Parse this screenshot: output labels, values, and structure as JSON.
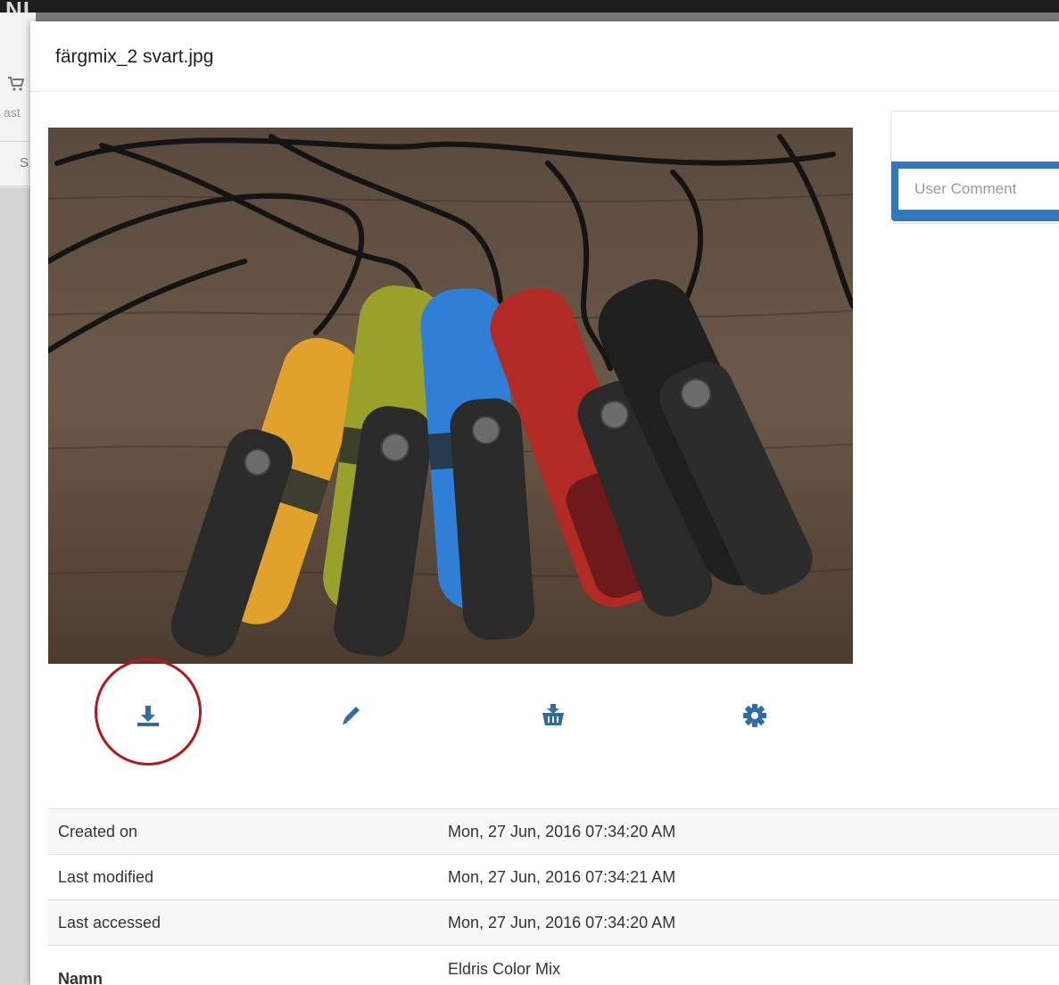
{
  "background": {
    "logo": "NI",
    "side_text_1": "ast",
    "side_text_2": "S"
  },
  "modal": {
    "title": "färgmix_2 svart.jpg",
    "comment": {
      "placeholder": "User Comment"
    },
    "actions": [
      {
        "name": "download",
        "icon": "download-icon"
      },
      {
        "name": "edit",
        "icon": "pencil-icon"
      },
      {
        "name": "add-to-basket",
        "icon": "basket-add-icon"
      },
      {
        "name": "settings",
        "icon": "gear-icon"
      }
    ],
    "properties": [
      {
        "key": "Created on",
        "value": "Mon, 27 Jun, 2016 07:34:20 AM"
      },
      {
        "key": "Last modified",
        "value": "Mon, 27 Jun, 2016 07:34:21 AM"
      },
      {
        "key": "Last accessed",
        "value": "Mon, 27 Jun, 2016 07:34:20 AM"
      },
      {
        "key": "Namn",
        "value": "Eldris Color Mix"
      }
    ]
  },
  "colors": {
    "accent": "#2e6da4",
    "highlight_ring": "#b8161b",
    "comment_border": "#3178bd"
  }
}
